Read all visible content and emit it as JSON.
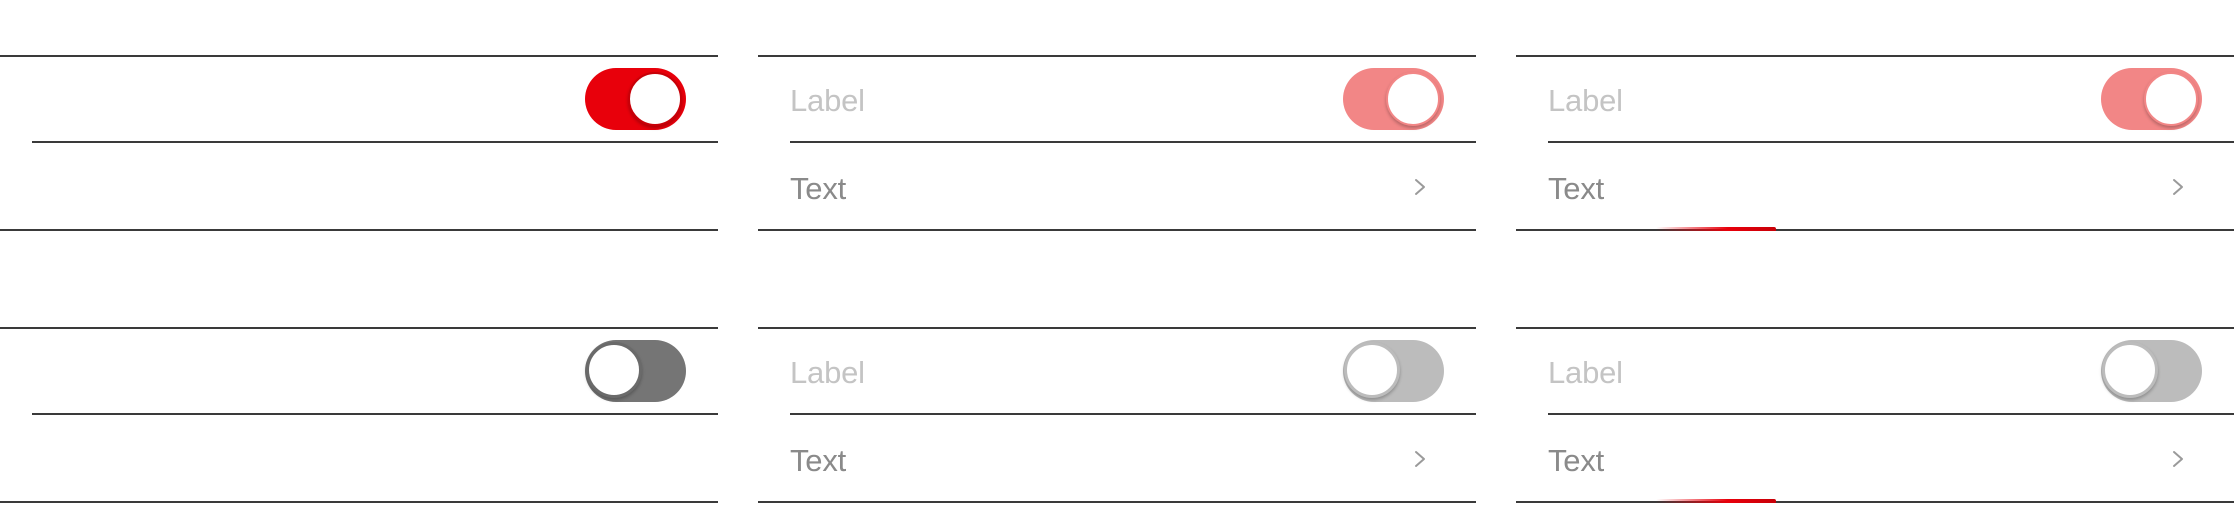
{
  "colors": {
    "accent": "#e8000b",
    "accent_disabled": "#f28686",
    "toggle_off": "#757575",
    "toggle_off_disabled": "#bcbcbc",
    "label": "#c4c4c4",
    "text": "#8a8a8a",
    "separator": "#3a3a3a"
  },
  "icons": {
    "chevron": "chevron-right-icon",
    "toggle": "toggle-switch-icon"
  },
  "groups": [
    {
      "state": "on",
      "variant": "normal",
      "label": "",
      "value": ""
    },
    {
      "state": "on",
      "variant": "disabled",
      "label": "Label",
      "value": "Text"
    },
    {
      "state": "on",
      "variant": "disabled-focus",
      "label": "Label",
      "value": "Text"
    },
    {
      "state": "off",
      "variant": "normal",
      "label": "",
      "value": ""
    },
    {
      "state": "off",
      "variant": "disabled",
      "label": "Label",
      "value": "Text"
    },
    {
      "state": "off",
      "variant": "disabled-focus",
      "label": "Label",
      "value": "Text"
    }
  ]
}
